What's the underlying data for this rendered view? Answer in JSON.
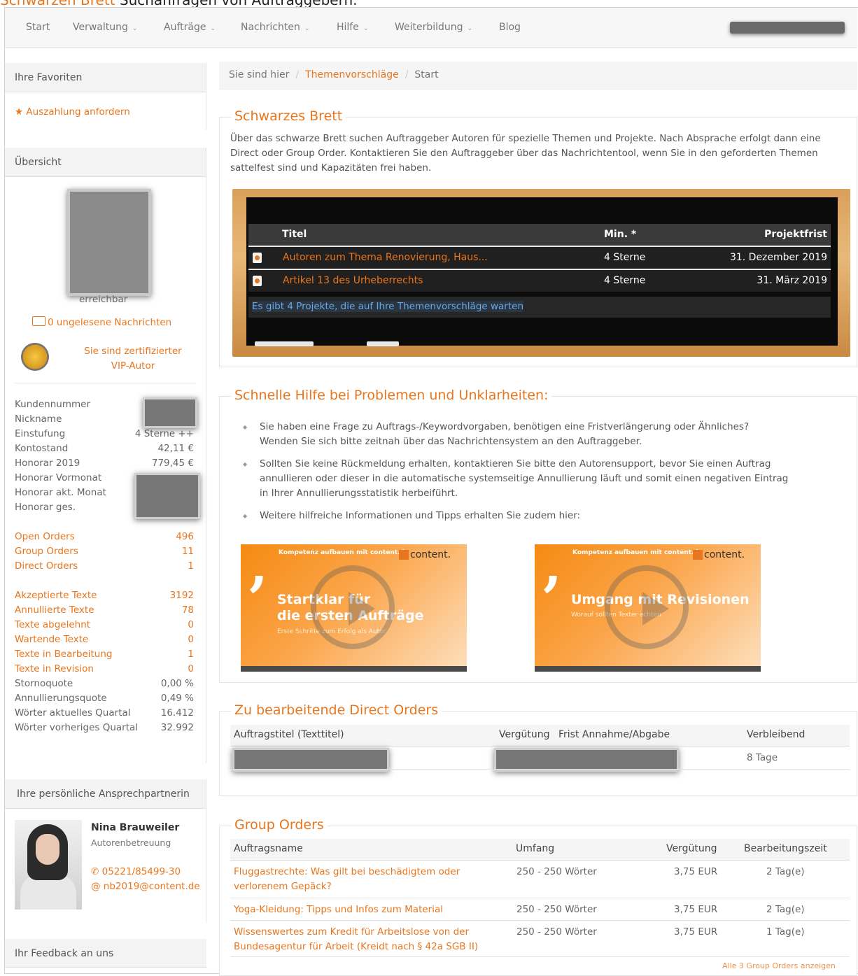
{
  "caption": {
    "accent": "Schwarzen Brett",
    "rest": " Suchanfragen von Auftraggebern."
  },
  "nav": {
    "items": [
      "Start",
      "Verwaltung",
      "Aufträge",
      "Nachrichten",
      "Hilfe",
      "Weiterbildung",
      "Blog"
    ],
    "chevron": "⌄"
  },
  "sidebar": {
    "favorites_title": "Ihre Favoriten",
    "favorite_link": "Auszahlung anfordern",
    "overview_title": "Übersicht",
    "status": "erreichbar",
    "messages": "0 ungelesene Nachrichten",
    "vip_line1": "Sie sind zertifizierter",
    "vip_line2": "VIP-Autor",
    "stats": [
      {
        "label": "Kundennummer",
        "value": ""
      },
      {
        "label": "Nickname",
        "value": ""
      },
      {
        "label": "Einstufung",
        "value": "4 Sterne ++"
      },
      {
        "label": "Kontostand",
        "value": "42,11 €"
      },
      {
        "label": "Honorar 2019",
        "value": "779,45 €"
      },
      {
        "label": "Honorar Vormonat",
        "value": ""
      },
      {
        "label": "Honorar akt. Monat",
        "value": ""
      },
      {
        "label": "Honorar ges.",
        "value": ""
      }
    ],
    "orders": [
      {
        "label": "Open Orders",
        "value": "496"
      },
      {
        "label": "Group Orders",
        "value": "11"
      },
      {
        "label": "Direct Orders",
        "value": "1"
      }
    ],
    "texts": [
      {
        "label": "Akzeptierte Texte",
        "value": "3192",
        "link": true
      },
      {
        "label": "Annullierte Texte",
        "value": "78",
        "link": true
      },
      {
        "label": "Texte abgelehnt",
        "value": "0",
        "link": true
      },
      {
        "label": "Wartende Texte",
        "value": "0",
        "link": true
      },
      {
        "label": "Texte in Bearbeitung",
        "value": "1",
        "link": true
      },
      {
        "label": "Texte in Revision",
        "value": "0",
        "link": true
      },
      {
        "label": "Stornoquote",
        "value": "0,00 %",
        "link": false
      },
      {
        "label": "Annullierungsquote",
        "value": "0,49 %",
        "link": false
      },
      {
        "label": "Wörter aktuelles Quartal",
        "value": "16.412",
        "link": false
      },
      {
        "label": "Wörter vorheriges Quartal",
        "value": "32.992",
        "link": false
      }
    ],
    "contact_title": "Ihre persönliche Ansprechpartnerin",
    "contact_name": "Nina Brauweiler",
    "contact_role": "Autorenbetreuung",
    "contact_phone": "05221/85499-30",
    "contact_email": "nb2019@content.de",
    "feedback_title": "Ihr Feedback an uns"
  },
  "breadcrumb": {
    "prefix": "Sie sind hier",
    "link": "Themenvorschläge",
    "current": "Start"
  },
  "board": {
    "title": "Schwarzes Brett",
    "description": "Über das schwarze Brett suchen Auftraggeber Autoren für spezielle Themen und Projekte. Nach Absprache erfolgt dann eine Direct oder Group Order. Kontaktieren Sie den Auftraggeber über das Nachrichtentool, wenn Sie in den geforderten Themen sattelfest sind und Kapazitäten frei haben.",
    "columns": [
      "Titel",
      "Min. *",
      "Projektfrist"
    ],
    "rows": [
      {
        "title": "Autoren zum Thema Renovierung, Haus...",
        "min": "4 Sterne",
        "deadline": "31. Dezember 2019"
      },
      {
        "title": "Artikel 13 des Urheberrechts",
        "min": "4 Sterne",
        "deadline": "31. März 2019"
      }
    ],
    "footer_link": "Es gibt 4 Projekte, die auf Ihre Themenvorschläge warten"
  },
  "help": {
    "title": "Schnelle Hilfe bei Problemen und Unklarheiten:",
    "items": [
      "Sie haben eine Frage zu Auftrags-/Keywordvorgaben, benötigen eine Fristverlängerung oder Ähnliches? Wenden Sie sich bitte zeitnah über das Nachrichtensystem an den Auftraggeber.",
      "Sollten Sie keine Rückmeldung erhalten, kontaktieren Sie bitte den Autorensupport, bevor Sie einen Auftrag annullieren oder dieser in die automatische systemseitige Annullierung läuft und somit einen negativen Eintrag in Ihrer Annullierungsstatistik herbeiführt.",
      "Weitere hilfreiche Informationen und Tipps erhalten Sie zudem hier:"
    ],
    "videos": [
      {
        "top": "Kompetenz aufbauen mit content.de",
        "logo": "content.",
        "title": "Startklar für\ndie ersten Aufträge",
        "subtitle": "Erste Schritte zum Erfolg als Autor"
      },
      {
        "top": "Kompetenz aufbauen mit content.de",
        "logo": "content.",
        "title": "Umgang mit Revisionen",
        "subtitle": "Worauf sollten Texter achten"
      }
    ]
  },
  "direct_orders": {
    "title": "Zu bearbeitende Direct Orders",
    "columns": [
      "Auftragstitel (Texttitel)",
      "Vergütung",
      "Frist Annahme/Abgabe",
      "Verbleibend"
    ],
    "rows": [
      {
        "remaining": "8 Tage"
      }
    ]
  },
  "group_orders": {
    "title": "Group Orders",
    "columns": [
      "Auftragsname",
      "Umfang",
      "Vergütung",
      "Bearbeitungszeit"
    ],
    "rows": [
      {
        "name": "Fluggastrechte: Was gilt bei beschädigtem oder\nverlorenem Gepäck?",
        "scope": "250 - 250 Wörter",
        "pay": "3,75 EUR",
        "time": "2 Tag(e)"
      },
      {
        "name": "Yoga-Kleidung: Tipps und Infos zum Material",
        "scope": "250 - 250 Wörter",
        "pay": "3,75 EUR",
        "time": "2 Tag(e)"
      },
      {
        "name": "Wissenswertes zum Kredit für Arbeitslose von der\nBundesagentur für Arbeit (Kreidt nach § 42a SGB II)",
        "scope": "250 - 250 Wörter",
        "pay": "3,75 EUR",
        "time": "1 Tag(e)"
      }
    ],
    "show_all": "Alle 3 Group Orders anzeigen"
  },
  "colors": {
    "accent": "#e8761e",
    "link_blue": "#6aa8e6",
    "board": "#0b0b0b"
  }
}
